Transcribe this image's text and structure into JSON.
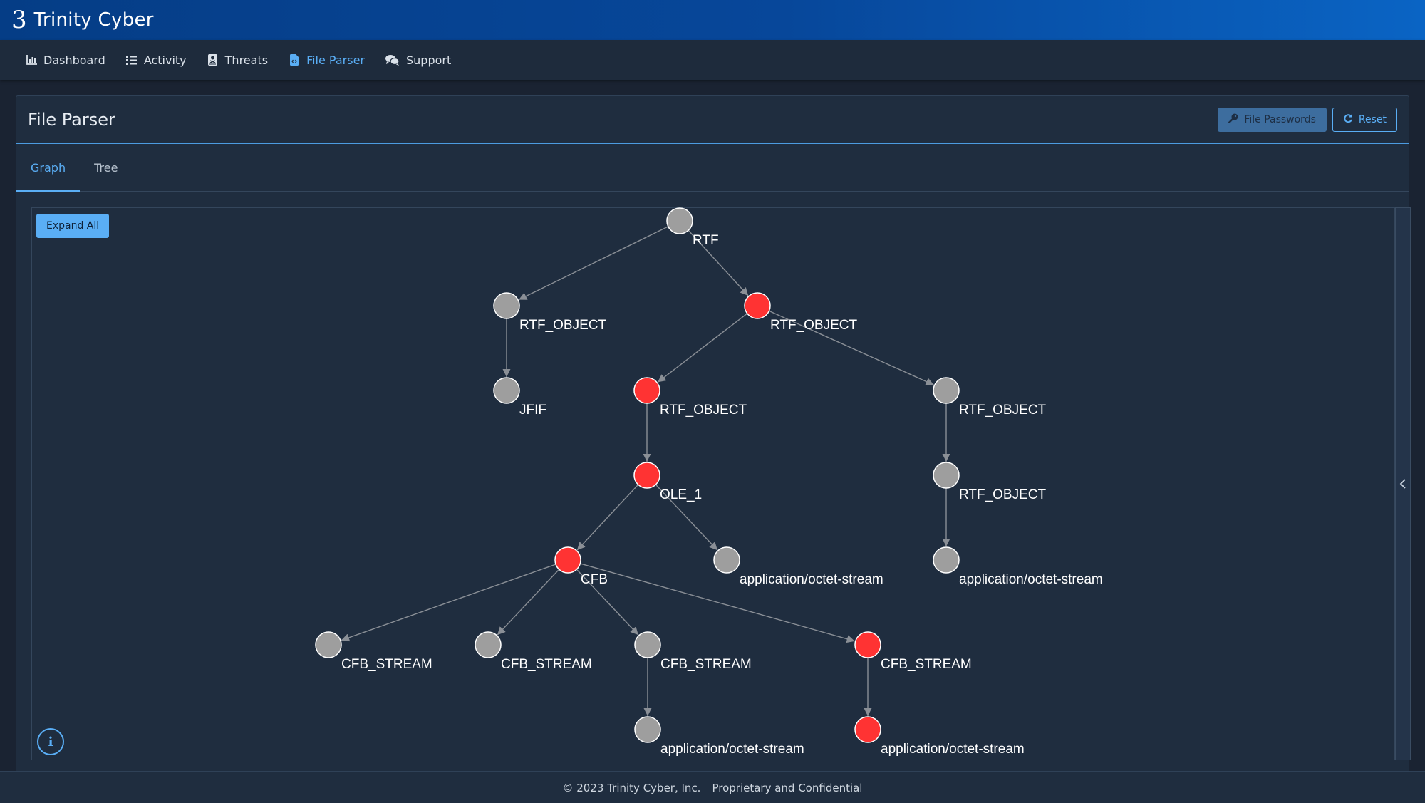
{
  "brand": {
    "logo": "3",
    "name": "Trinity Cyber"
  },
  "nav": {
    "items": [
      {
        "label": "Dashboard",
        "icon": "chart-bar-icon",
        "active": false
      },
      {
        "label": "Activity",
        "icon": "list-icon",
        "active": false
      },
      {
        "label": "Threats",
        "icon": "skull-book-icon",
        "active": false
      },
      {
        "label": "File Parser",
        "icon": "file-code-icon",
        "active": true
      },
      {
        "label": "Support",
        "icon": "comments-icon",
        "active": false
      }
    ]
  },
  "page": {
    "title": "File Parser",
    "buttons": {
      "file_passwords": "File Passwords",
      "reset": "Reset"
    },
    "tabs": [
      {
        "label": "Graph",
        "active": true
      },
      {
        "label": "Tree",
        "active": false
      }
    ],
    "expand_all": "Expand All",
    "info_icon": "i"
  },
  "colors": {
    "accent": "#5aaef5",
    "threat_node": "#ff3333",
    "normal_node": "#9e9e9e",
    "edge": "#8a8f96"
  },
  "graph": {
    "nodes": [
      {
        "id": "n0",
        "label": "RTF",
        "threat": false
      },
      {
        "id": "n1",
        "label": "RTF_OBJECT",
        "threat": false
      },
      {
        "id": "n2",
        "label": "RTF_OBJECT",
        "threat": true
      },
      {
        "id": "n3",
        "label": "JFIF",
        "threat": false
      },
      {
        "id": "n4",
        "label": "RTF_OBJECT",
        "threat": true
      },
      {
        "id": "n5",
        "label": "RTF_OBJECT",
        "threat": false
      },
      {
        "id": "n6",
        "label": "OLE_1",
        "threat": true
      },
      {
        "id": "n7",
        "label": "RTF_OBJECT",
        "threat": false
      },
      {
        "id": "n8",
        "label": "CFB",
        "threat": true
      },
      {
        "id": "n9",
        "label": "application/octet-stream",
        "threat": false
      },
      {
        "id": "n10",
        "label": "application/octet-stream",
        "threat": false
      },
      {
        "id": "n11",
        "label": "CFB_STREAM",
        "threat": false
      },
      {
        "id": "n12",
        "label": "CFB_STREAM",
        "threat": false
      },
      {
        "id": "n13",
        "label": "CFB_STREAM",
        "threat": false
      },
      {
        "id": "n14",
        "label": "CFB_STREAM",
        "threat": true
      },
      {
        "id": "n15",
        "label": "application/octet-stream",
        "threat": false
      },
      {
        "id": "n16",
        "label": "application/octet-stream",
        "threat": true
      }
    ],
    "edges": [
      [
        "n0",
        "n1"
      ],
      [
        "n0",
        "n2"
      ],
      [
        "n1",
        "n3"
      ],
      [
        "n2",
        "n4"
      ],
      [
        "n2",
        "n5"
      ],
      [
        "n4",
        "n6"
      ],
      [
        "n5",
        "n7"
      ],
      [
        "n6",
        "n8"
      ],
      [
        "n6",
        "n9"
      ],
      [
        "n7",
        "n10"
      ],
      [
        "n8",
        "n11"
      ],
      [
        "n8",
        "n12"
      ],
      [
        "n8",
        "n13"
      ],
      [
        "n8",
        "n14"
      ],
      [
        "n13",
        "n15"
      ],
      [
        "n14",
        "n16"
      ]
    ]
  },
  "footer": {
    "copyright": "© 2023 Trinity Cyber, Inc.",
    "notice": "Proprietary and Confidential"
  }
}
